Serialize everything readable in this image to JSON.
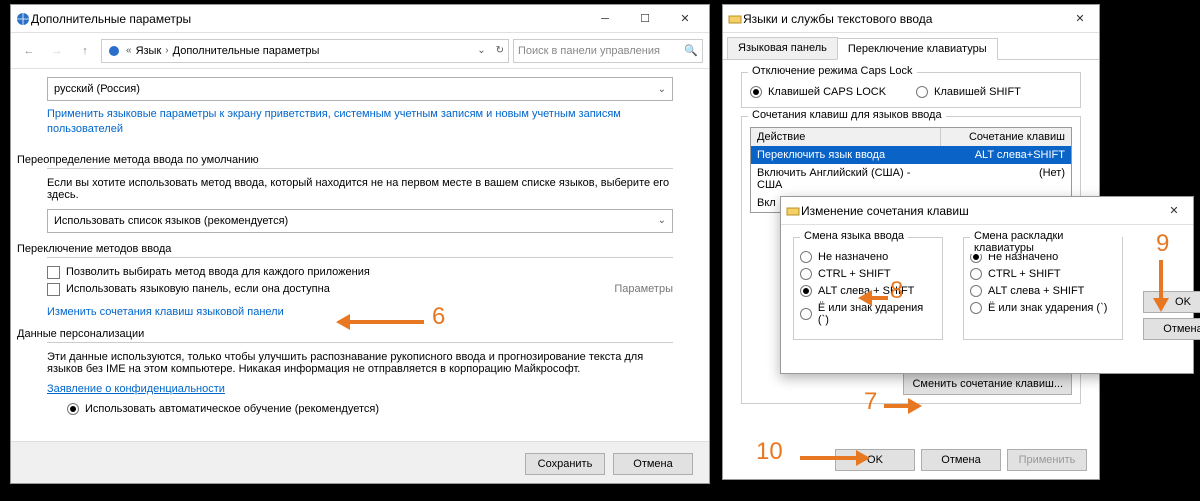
{
  "win1": {
    "title": "Дополнительные параметры",
    "breadcrumb": {
      "root": "Язык",
      "current": "Дополнительные параметры"
    },
    "search_placeholder": "Поиск в панели управления",
    "lang_dropdown": "русский (Россия)",
    "apply_link": "Применить языковые параметры к экрану приветствия, системным учетным записям и новым учетным записям пользователей",
    "s2_title": "Переопределение метода ввода по умолчанию",
    "s2_text": "Если вы хотите использовать метод ввода, который находится не на первом месте в вашем списке языков, выберите его здесь.",
    "s2_dropdown": "Использовать список языков (рекомендуется)",
    "s3_title": "Переключение методов ввода",
    "s3_cb1": "Позволить выбирать метод ввода для каждого приложения",
    "s3_cb2": "Использовать языковую панель, если она доступна",
    "s3_params": "Параметры",
    "s3_link": "Изменить сочетания клавиш языковой панели",
    "s4_title": "Данные персонализации",
    "s4_text": "Эти данные используются, только чтобы улучшить распознавание рукописного ввода и прогнозирование текста для языков без IME на этом компьютере. Никакая информация не отправляется в корпорацию Майкрософт.",
    "s4_link": "Заявление о конфиденциальности",
    "s4_radio": "Использовать автоматическое обучение (рекомендуется)",
    "save": "Сохранить",
    "cancel": "Отмена"
  },
  "win2": {
    "title": "Языки и службы текстового ввода",
    "tab1": "Языковая панель",
    "tab2": "Переключение клавиатуры",
    "caps_group": "Отключение режима Caps Lock",
    "caps_r1": "Клавишей CAPS LOCK",
    "caps_r2": "Клавишей SHIFT",
    "hot_group": "Сочетания клавиш для языков ввода",
    "th1": "Действие",
    "th2": "Сочетание клавиш",
    "r1a": "Переключить язык ввода",
    "r1b": "ALT слева+SHIFT",
    "r2a": "Включить Английский (США) - США",
    "r2b": "(Нет)",
    "r3a": "Вкл",
    "change_btn": "Сменить сочетание клавиш...",
    "ok": "OK",
    "cancel": "Отмена",
    "apply": "Применить"
  },
  "win3": {
    "title": "Изменение сочетания клавиш",
    "col1": "Смена языка ввода",
    "col2": "Смена раскладки клавиатуры",
    "o1": "Не назначено",
    "o2": "CTRL + SHIFT",
    "o3": "ALT слева + SHIFT",
    "o4": "Ё или знак ударения (`)",
    "ok": "OK",
    "cancel": "Отмена"
  },
  "anno": {
    "n6": "6",
    "n7": "7",
    "n8": "8",
    "n9": "9",
    "n10": "10"
  }
}
